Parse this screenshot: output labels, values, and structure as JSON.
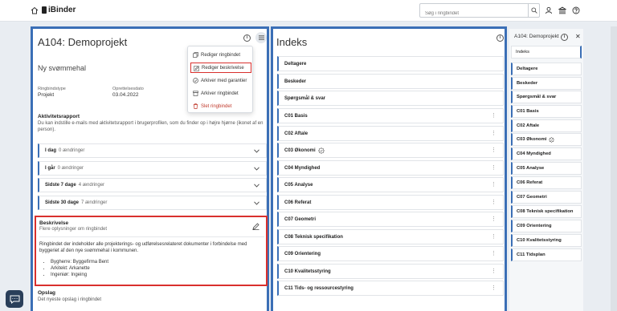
{
  "header": {
    "logo": "iBinder",
    "search_placeholder": "Søg i ringbindet"
  },
  "main_panel": {
    "title": "A104: Demoprojekt",
    "project_name": "Ny svømmehal",
    "type_label": "Ringbindstype",
    "type_value": "Projekt",
    "created_label": "Oprettelsesdato",
    "created_value": "03.04.2022",
    "activity_title": "Aktivitetsrapport",
    "activity_text": "Du kan indstille e-mails med aktivitetsrapport i brugerprofilen, som du finder op i højre hjørne (ikonet af en person).",
    "activity_rows": [
      {
        "label": "I dag",
        "count": "0 ændringer"
      },
      {
        "label": "I går",
        "count": "0 ændringer"
      },
      {
        "label": "Sidste 7 dage",
        "count": "4 ændringer"
      },
      {
        "label": "Sidste 30 dage",
        "count": "7 ændringer"
      }
    ],
    "description": {
      "title": "Beskrivelse",
      "subtitle": "Flere oplysninger om ringbindet",
      "text": "Ringbindet der indeholder alle projekterings- og udførelsesrelateret dokumenter i forbindelse med byggeriet af den nye svømmehal i kommunen.",
      "bullets": [
        "Bygherre: Byggefirma Bent",
        "Arkitekt: Arkanette",
        "Ingeniør: Ingeing"
      ]
    },
    "post_title": "Opslag",
    "post_subtitle": "Det nyeste opslag i ringbindet"
  },
  "menu": {
    "items": [
      {
        "label": "Rediger ringbindet",
        "icon": "copy-icon"
      },
      {
        "label": "Rediger beskrivelse",
        "icon": "edit-icon"
      },
      {
        "label": "Arkiver med garantier",
        "icon": "check-circle-icon"
      },
      {
        "label": "Arkiver ringbindet",
        "icon": "archive-icon"
      },
      {
        "label": "Slet ringbindet",
        "icon": "trash-icon"
      }
    ]
  },
  "index_panel": {
    "title": "Indeks",
    "rows": [
      "Deltagere",
      "Beskeder",
      "Spørgsmål & svar",
      "C01 Basis",
      "C02 Aftale",
      "C03 Økonomi",
      "C04 Myndighed",
      "C05 Analyse",
      "C06 Referat",
      "C07 Geometri",
      "C08 Teknisk specifikation",
      "C09 Orientering",
      "C10 Kvalitetsstyring",
      "C11 Tids- og ressourcestyring"
    ]
  },
  "right_panel": {
    "title": "A104: Demoprojekt",
    "rows": [
      "Indeks",
      "Deltagere",
      "Beskeder",
      "Spørgsmål & svar",
      "C01 Basis",
      "C02 Aftale",
      "C03 Økonomi",
      "C04 Myndighed",
      "C05 Analyse",
      "C06 Referat",
      "C07 Geometri",
      "C08 Teknisk specifikation",
      "C09 Orientering",
      "C10 Kvalitetsstyring",
      "C11 Tidsplan"
    ]
  },
  "colors": {
    "accent": "#3b6fb6",
    "highlight": "#d9302d"
  }
}
